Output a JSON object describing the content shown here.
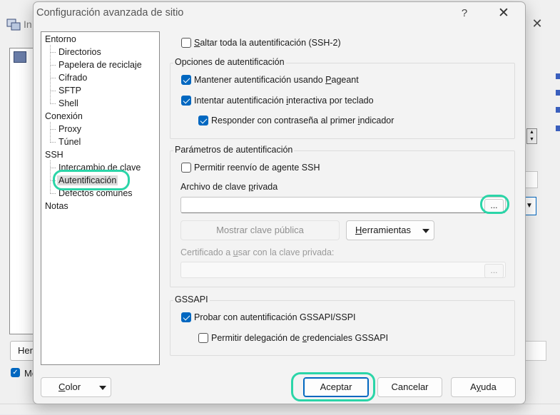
{
  "background_window": {
    "title": "In",
    "close_glyph": "✕",
    "button_label": "Her",
    "checkbox_label": "Mo"
  },
  "dialog": {
    "title": "Configuración avanzada de sitio",
    "help_glyph": "?",
    "close_glyph": "✕"
  },
  "tree": {
    "items": [
      {
        "label": "Entorno"
      },
      {
        "label": "Directorios"
      },
      {
        "label": "Papelera de reciclaje"
      },
      {
        "label": "Cifrado"
      },
      {
        "label": "SFTP"
      },
      {
        "label": "Shell"
      },
      {
        "label": "Conexión"
      },
      {
        "label": "Proxy"
      },
      {
        "label": "Túnel"
      },
      {
        "label": "SSH"
      },
      {
        "label": "Intercambio de clave"
      },
      {
        "label": "Autentificación"
      },
      {
        "label": "Defectos comunes"
      },
      {
        "label": "Notas"
      }
    ],
    "selected": "Autentificación"
  },
  "skip_auth": {
    "checked": false,
    "label_pre": "",
    "label_key": "S",
    "label_post": "altar toda la autentificación (SSH-2)"
  },
  "auth_options": {
    "title": "Opciones de autentificación",
    "pageant": {
      "checked": true,
      "label_pre": "Mantener autentificación usando ",
      "label_key": "P",
      "label_post": "ageant"
    },
    "keyboard": {
      "checked": true,
      "label_pre": "Intentar autentificación ",
      "label_key": "i",
      "label_post": "nteractiva por teclado"
    },
    "respond": {
      "checked": true,
      "label_pre": "Responder con contraseña al primer ",
      "label_key": "i",
      "label_post": "ndicador"
    }
  },
  "auth_params": {
    "title": "Parámetros de autentificación",
    "agent_fwd": {
      "checked": false,
      "label_pre": "Permitir reenvío de agente SSH"
    },
    "private_key_label_pre": "Archivo de clave ",
    "private_key_label_key": "p",
    "private_key_label_post": "rivada",
    "private_key_value": "",
    "browse_label": "...",
    "show_public_key": "Mostrar clave pública",
    "tools_key": "H",
    "tools_rest": "erramientas",
    "certificate_label_pre": "Certificado a ",
    "certificate_label_key": "u",
    "certificate_label_post": "sar con la clave privada:",
    "certificate_value": "",
    "cert_browse_label": "..."
  },
  "gssapi": {
    "title": "GSSAPI",
    "try": {
      "checked": true,
      "label": "Probar con autentificación GSSAPI/SSPI"
    },
    "delegate": {
      "checked": false,
      "label_pre": "Permitir delegación de ",
      "label_key": "c",
      "label_post": "redenciales GSSAPI"
    }
  },
  "footer": {
    "color_key": "C",
    "color_rest": "olor",
    "ok": "Aceptar",
    "cancel": "Cancelar",
    "help_key": "y",
    "help_pre": "A",
    "help_post": "uda"
  },
  "highlight_color": "#2bd5a8",
  "accent_color": "#0067c0"
}
